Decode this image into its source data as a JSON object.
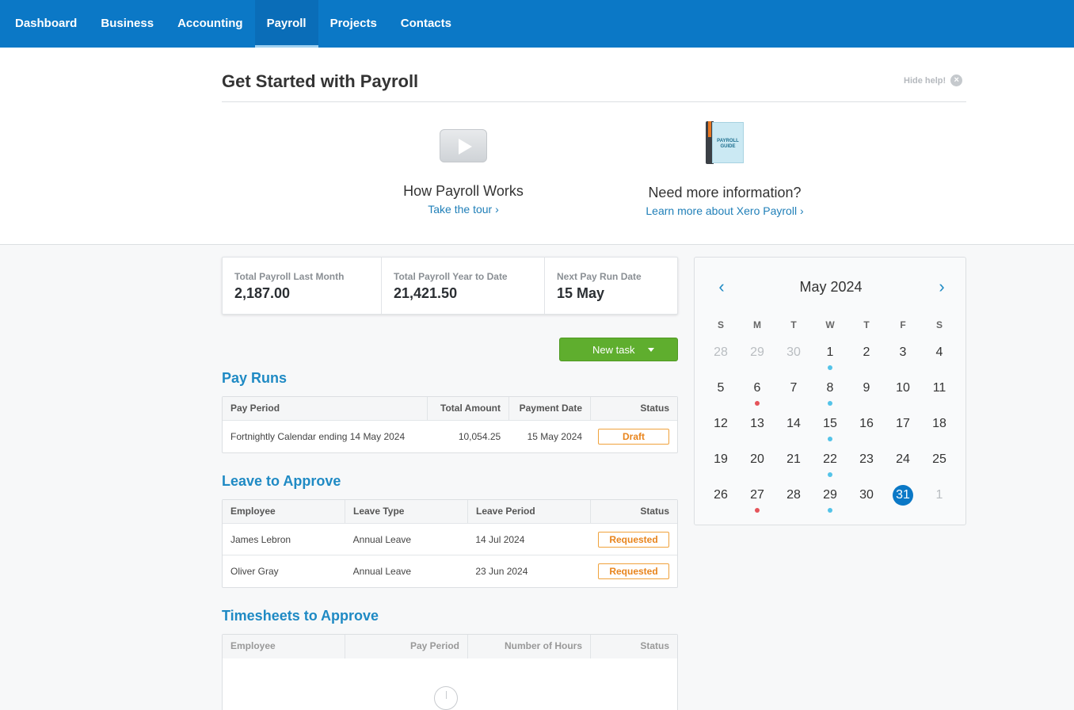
{
  "nav": {
    "items": [
      "Dashboard",
      "Business",
      "Accounting",
      "Payroll",
      "Projects",
      "Contacts"
    ],
    "active": "Payroll"
  },
  "help": {
    "title": "Get Started with Payroll",
    "hide_label": "Hide help!",
    "close_glyph": "×",
    "video": {
      "heading": "How Payroll Works",
      "link": "Take the tour ›"
    },
    "guide": {
      "heading": "Need more information?",
      "link": "Learn more about Xero Payroll ›",
      "book_text": "PAYROLL GUIDE"
    }
  },
  "stats": [
    {
      "label": "Total Payroll Last Month",
      "value": "2,187.00"
    },
    {
      "label": "Total Payroll Year to Date",
      "value": "21,421.50"
    },
    {
      "label": "Next Pay Run Date",
      "value": "15 May"
    }
  ],
  "new_task_label": "New task",
  "pay_runs": {
    "title": "Pay Runs",
    "headers": [
      "Pay Period",
      "Total Amount",
      "Payment Date",
      "Status"
    ],
    "rows": [
      {
        "period": "Fortnightly Calendar ending 14 May 2024",
        "amount": "10,054.25",
        "date": "15 May 2024",
        "status": "Draft"
      }
    ]
  },
  "leave": {
    "title": "Leave to Approve",
    "headers": [
      "Employee",
      "Leave Type",
      "Leave Period",
      "Status"
    ],
    "rows": [
      {
        "employee": "James Lebron",
        "type": "Annual Leave",
        "period": "14 Jul 2024",
        "status": "Requested"
      },
      {
        "employee": "Oliver Gray",
        "type": "Annual Leave",
        "period": "23 Jun 2024",
        "status": "Requested"
      }
    ]
  },
  "timesheets": {
    "title": "Timesheets to Approve",
    "headers": [
      "Employee",
      "Pay Period",
      "Number of Hours",
      "Status"
    ]
  },
  "calendar": {
    "title": "May 2024",
    "prev_glyph": "‹",
    "next_glyph": "›",
    "dow": [
      "S",
      "M",
      "T",
      "W",
      "T",
      "F",
      "S"
    ],
    "weeks": [
      [
        "28",
        "29",
        "30",
        "1",
        "2",
        "3",
        "4"
      ],
      [
        "5",
        "6",
        "7",
        "8",
        "9",
        "10",
        "11"
      ],
      [
        "12",
        "13",
        "14",
        "15",
        "16",
        "17",
        "18"
      ],
      [
        "19",
        "20",
        "21",
        "22",
        "23",
        "24",
        "25"
      ],
      [
        "26",
        "27",
        "28",
        "29",
        "30",
        "31",
        "1"
      ]
    ],
    "colors": {
      "blue_dot": "#54c3e8",
      "red_dot": "#e5545a",
      "today": "#0b78c6"
    }
  }
}
